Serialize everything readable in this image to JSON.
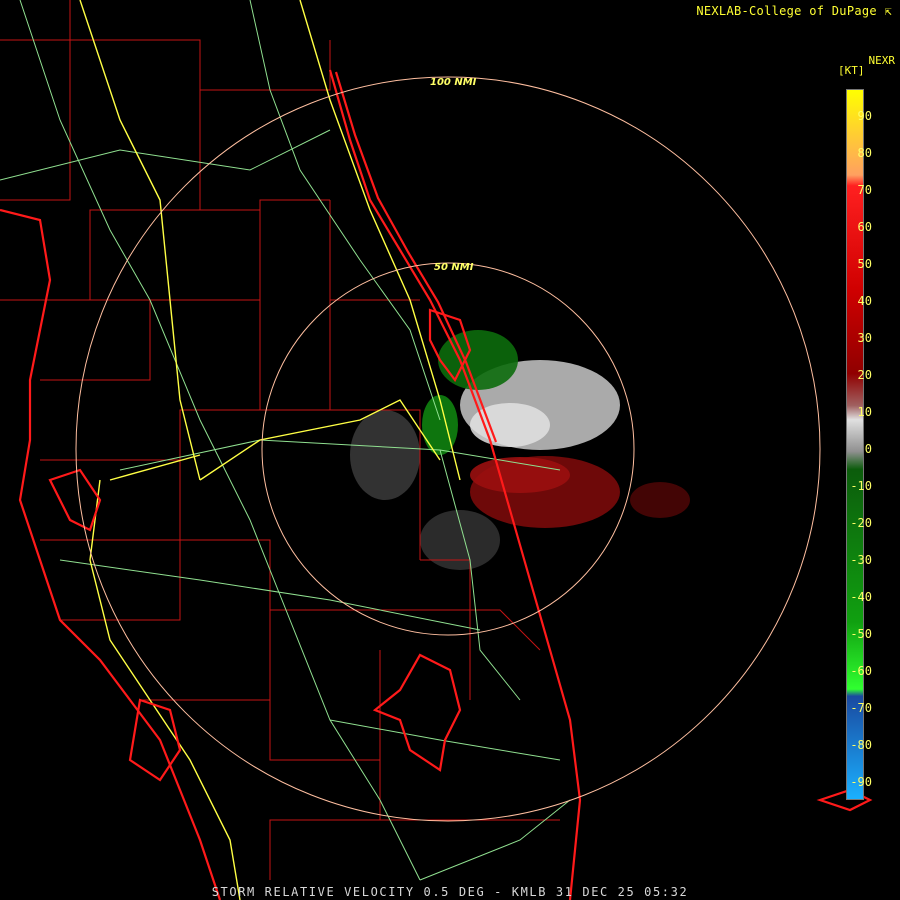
{
  "header": {
    "credit": "NEXLAB-College of DuPage",
    "credit_icon": "cursor-arrow-icon"
  },
  "legend": {
    "product": "NEXR",
    "unit": "[KT]",
    "ticks": [
      "90",
      "80",
      "70",
      "60",
      "50",
      "40",
      "30",
      "20",
      "10",
      "0",
      "-10",
      "-20",
      "-30",
      "-40",
      "-50",
      "-60",
      "-70",
      "-80",
      "-90"
    ],
    "gradient": [
      {
        "stop": 0.0,
        "color": "#ffff00"
      },
      {
        "stop": 0.12,
        "color": "#ffa060"
      },
      {
        "stop": 0.135,
        "color": "#ff2020"
      },
      {
        "stop": 0.28,
        "color": "#d00000"
      },
      {
        "stop": 0.4,
        "color": "#900000"
      },
      {
        "stop": 0.445,
        "color": "#a06060"
      },
      {
        "stop": 0.465,
        "color": "#e0e0e0"
      },
      {
        "stop": 0.51,
        "color": "#909090"
      },
      {
        "stop": 0.535,
        "color": "#0c5c0c"
      },
      {
        "stop": 0.75,
        "color": "#10a010"
      },
      {
        "stop": 0.845,
        "color": "#30ff30"
      },
      {
        "stop": 0.855,
        "color": "#1a4aa0"
      },
      {
        "stop": 1.0,
        "color": "#1ab0ff"
      }
    ]
  },
  "range_rings": [
    {
      "label": "100 NMI"
    },
    {
      "label": "50 NMI"
    }
  ],
  "colors": {
    "coast": "#ff1a1a",
    "county": "#c41414",
    "road": "#90e090",
    "highway": "#ffff44",
    "ring": "#ffbfa0"
  },
  "footer": {
    "caption": "STORM RELATIVE VELOCITY 0.5 DEG - KMLB 31 DEC 25 05:32"
  }
}
